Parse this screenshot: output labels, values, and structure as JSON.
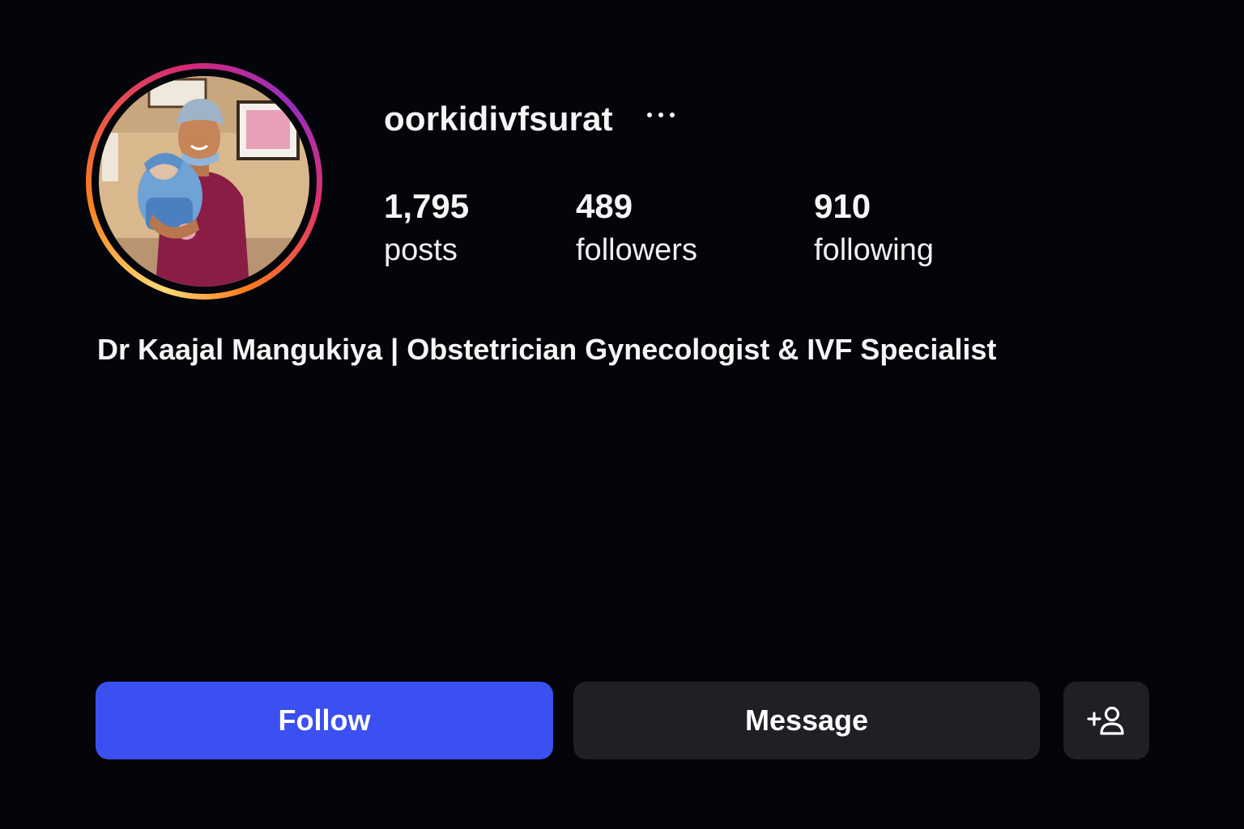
{
  "profile": {
    "username": "oorkidivfsurat",
    "bio": "Dr Kaajal Mangukiya | Obstetrician Gynecologist & IVF Specialist"
  },
  "stats": [
    {
      "value": "1,795",
      "label": "posts"
    },
    {
      "value": "489",
      "label": "followers"
    },
    {
      "value": "910",
      "label": "following"
    }
  ],
  "actions": {
    "follow_label": "Follow",
    "message_label": "Message",
    "suggest_icon": "add-person-icon",
    "more_icon": "more-options-icon"
  },
  "colors": {
    "background": "#04050a",
    "follow_button": "#3b50f0",
    "secondary_button": "#1f2024",
    "text": "#f5f5f5"
  }
}
